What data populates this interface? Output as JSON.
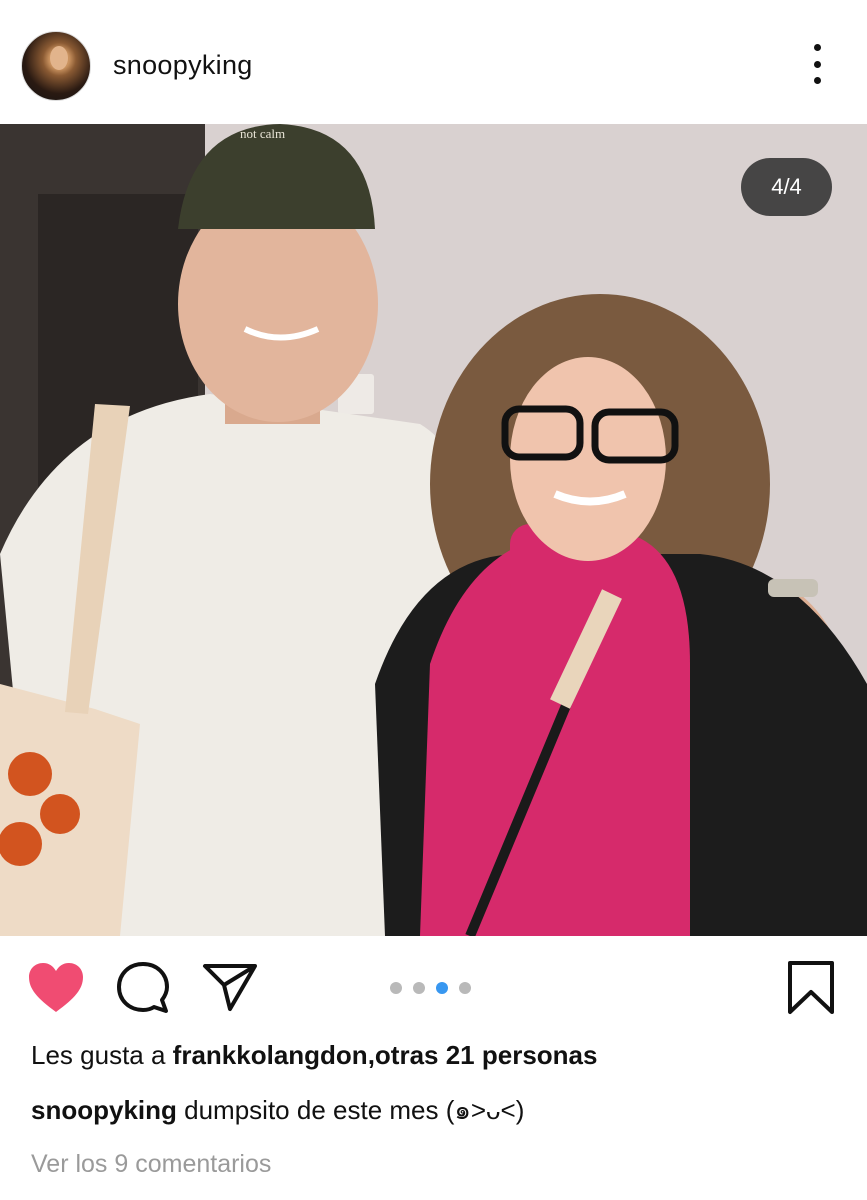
{
  "post": {
    "username": "snoopyking",
    "avatar_icon": "profile-avatar",
    "more_icon": "more-vertical-icon",
    "image": {
      "counter": "4/4",
      "alt": ""
    },
    "carousel": {
      "count": 4,
      "active_index": 2
    },
    "icons": {
      "like": "heart-filled-icon",
      "comment": "comment-icon",
      "share": "send-icon",
      "save": "bookmark-icon"
    },
    "likes": {
      "prefix": "Les gusta a",
      "user": "frankkolangdon",
      "others": "otras 21 personas"
    },
    "caption": {
      "username": "snoopyking",
      "text": "dumpsito de este mes (๑˃ᴗ˂)"
    },
    "view_comments": "Ver los 9 comentarios"
  },
  "colors": {
    "like": "#f04c72",
    "carousel_active": "#3897f0",
    "carousel_inactive": "#b9b9b9",
    "muted_text": "#9a9a9a"
  }
}
